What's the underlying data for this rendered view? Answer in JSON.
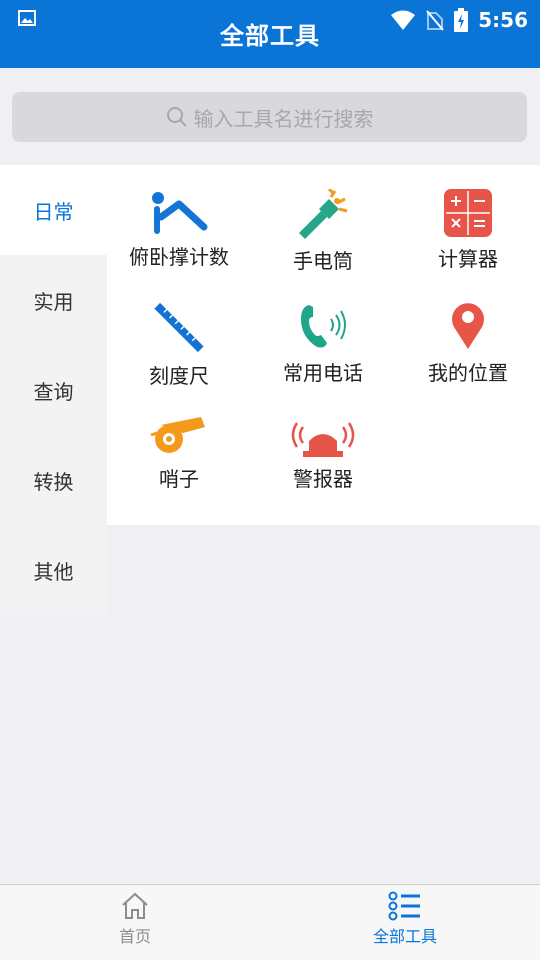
{
  "status": {
    "time": "5:56",
    "icons": [
      "image-icon",
      "wifi-icon",
      "no-sim-icon",
      "battery-charging-icon"
    ]
  },
  "header": {
    "title": "全部工具"
  },
  "search": {
    "placeholder": "输入工具名进行搜索",
    "icon": "search-icon"
  },
  "sidebar": {
    "items": [
      {
        "label": "日常",
        "active": true
      },
      {
        "label": "实用",
        "active": false
      },
      {
        "label": "查询",
        "active": false
      },
      {
        "label": "转换",
        "active": false
      },
      {
        "label": "其他",
        "active": false
      }
    ]
  },
  "tools": [
    {
      "label": "俯卧撑计数",
      "icon": "pushup-icon",
      "color": "#1376d6"
    },
    {
      "label": "手电筒",
      "icon": "flashlight-icon",
      "color": "#27a58a"
    },
    {
      "label": "计算器",
      "icon": "calculator-icon",
      "color": "#e65548"
    },
    {
      "label": "刻度尺",
      "icon": "ruler-icon",
      "color": "#1273d3"
    },
    {
      "label": "常用电话",
      "icon": "phone-icon",
      "color": "#1fa58b"
    },
    {
      "label": "我的位置",
      "icon": "location-pin-icon",
      "color": "#e65548"
    },
    {
      "label": "哨子",
      "icon": "whistle-icon",
      "color": "#f39a1c"
    },
    {
      "label": "警报器",
      "icon": "alarm-icon",
      "color": "#e65548"
    }
  ],
  "bottom_nav": [
    {
      "label": "首页",
      "icon": "home-icon",
      "active": false
    },
    {
      "label": "全部工具",
      "icon": "list-icon",
      "active": true
    }
  ],
  "colors": {
    "primary": "#0a74d7",
    "inactive": "#8c8c8c"
  }
}
